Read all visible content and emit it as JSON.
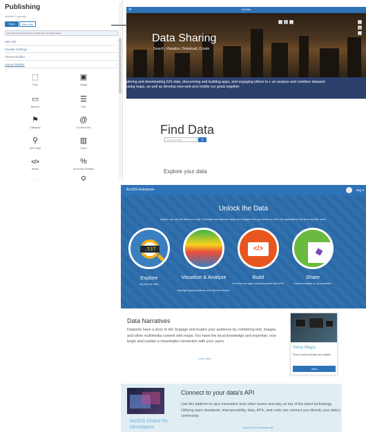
{
  "panel": {
    "title": "Publishing",
    "subtitle": "Updated 3 days ago",
    "save_label": "Save",
    "view_label": "View Site",
    "notice": "We recommend you work in a single tab to avoid lost work.",
    "sections": [
      {
        "label": "Site Info"
      },
      {
        "label": "Header Settings"
      },
      {
        "label": "Theme Builder"
      },
      {
        "label": "Layout Builder"
      }
    ],
    "tiles": [
      {
        "label": "Row",
        "icon": "row-icon",
        "glyph": "⬚"
      },
      {
        "label": "Image",
        "icon": "image-icon",
        "glyph": "▣"
      },
      {
        "label": "Banner",
        "icon": "banner-icon",
        "glyph": "▭"
      },
      {
        "label": "Text",
        "icon": "text-icon",
        "glyph": "☰"
      },
      {
        "label": "Category",
        "icon": "flag-icon",
        "glyph": "⚑"
      },
      {
        "label": "Contact Info",
        "icon": "at-icon",
        "glyph": "@"
      },
      {
        "label": "Web Map",
        "icon": "map-pin-icon",
        "glyph": "⚲"
      },
      {
        "label": "Chart",
        "icon": "chart-icon",
        "glyph": "▥"
      },
      {
        "label": "iframe",
        "icon": "code-icon",
        "glyph": "</>"
      },
      {
        "label": "Summary Statistic",
        "icon": "percent-icon",
        "glyph": "%"
      },
      {
        "label": "",
        "icon": "more-icon",
        "glyph": "..."
      },
      {
        "label": "",
        "icon": "search-icon",
        "glyph": "⚲"
      }
    ]
  },
  "preview": {
    "topbar_title": "My Data",
    "hero_title": "Data Sharing",
    "hero_subtitle": "Search, Visualize, Download, Create",
    "band_text": "ploring and downloading GIS data, discovering and building apps, and engaging others to c an analyze and combine datasets using maps, as well as develop new web and mobile our goals together",
    "find_title": "Find Data",
    "search_placeholder": "Search for Data",
    "explore_title": "Explore your data"
  },
  "site": {
    "brand": "ArcGIS Enterprise",
    "user": "Jing",
    "unlock_title": "Unlock the Data",
    "unlock_sub": "Anyone can use this data at no cost. Download raw data and share your insights with your teams or build new applications that serve specific users.",
    "cards": [
      {
        "title": "Explore",
        "desc": "Dig into the data.",
        "readout": ".537"
      },
      {
        "title": "Visualize & Analyze",
        "desc": "Highlight spatial patterns and discover trends."
      },
      {
        "title": "Build",
        "desc": "Develop new apps using templates and APIs."
      },
      {
        "title": "Share",
        "desc": "Embed analysis on your website."
      }
    ],
    "narr_title": "Data Narratives",
    "narr_body": "Datasets have a story to tell. Engage and inspire your audience by combining text, images, and other multimedia content with maps. You have the local knowledge and expertise, now begin and sustain a meaningful connection with your users.",
    "learn_more": "Learn More",
    "story_title": "Story Maps",
    "story_desc": "Share local knowledge and insights.",
    "story_btn": "View",
    "api_label": "ArcGIS Online for Developers",
    "api_title": "Connect to your data's API",
    "api_body": "Use this platform to spur innovation from other teams and stay on top of the latest technology. Utilizing open standards, interoperability, data, APIs, and code can connect you directly your data's community.",
    "api_link": "Visit ArcGIS Developer API"
  },
  "colors": {
    "accent": "#2e72b8",
    "band": "#2b3f6b",
    "unlock": "#2a6aa8"
  }
}
